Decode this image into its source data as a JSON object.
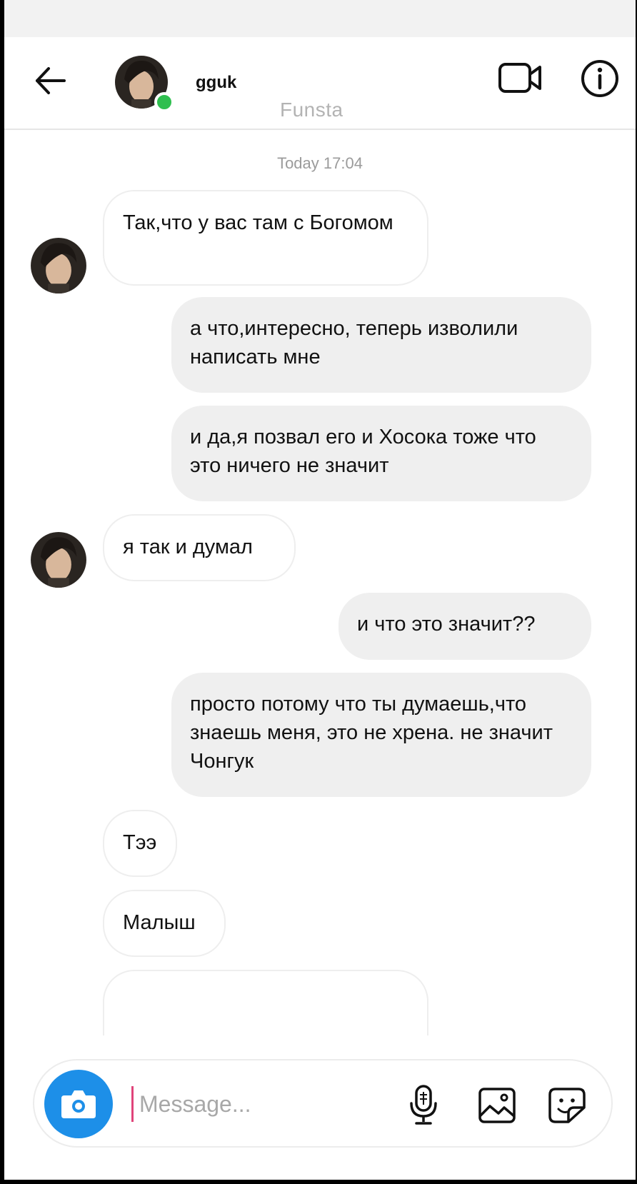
{
  "header": {
    "username": "gguk",
    "subtitle": "Funsta",
    "icons": {
      "back": "arrow-left-icon",
      "video": "video-camera-icon",
      "info": "info-icon"
    },
    "online_color": "#2fbf4f"
  },
  "thread": {
    "timestamp": "Today 17:04",
    "messages": [
      {
        "from": "them",
        "text": "Так,что у вас там с Богомом"
      },
      {
        "from": "me",
        "text": "а что,интересно, теперь изволили написать мне"
      },
      {
        "from": "me",
        "text": "и да,я позвал его и Хосока тоже что это ничего не значит"
      },
      {
        "from": "them",
        "text": "я так и думал"
      },
      {
        "from": "me",
        "text": "и что это значит??"
      },
      {
        "from": "me",
        "text": "просто потому что ты думаешь,что знаешь меня, это не хрена. не значит Чонгук"
      },
      {
        "from": "them",
        "text": "Тээ"
      },
      {
        "from": "them",
        "text": "Малыш"
      }
    ]
  },
  "composer": {
    "placeholder": "Message...",
    "icons": {
      "camera": "camera-icon",
      "mic": "microphone-icon",
      "gallery": "gallery-icon",
      "sticker": "sticker-icon"
    },
    "accent_color": "#1d8fe8"
  }
}
